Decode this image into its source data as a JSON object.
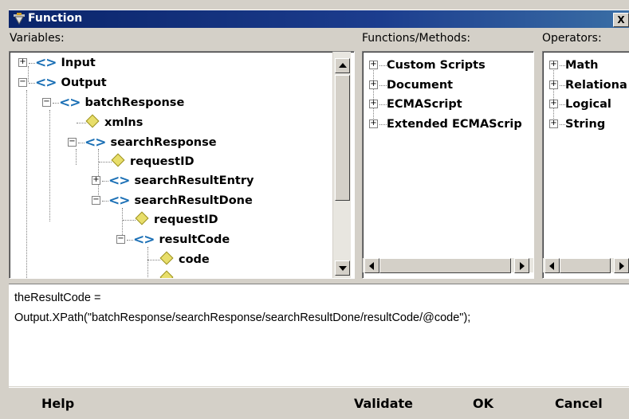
{
  "window": {
    "title": "Function",
    "close_label": "X"
  },
  "panels": {
    "variables": {
      "label": "Variables:",
      "items": [
        {
          "label": "Input",
          "type": "element",
          "expander": "+"
        },
        {
          "label": "Output",
          "type": "element",
          "expander": "−"
        },
        {
          "label": "batchResponse",
          "type": "element",
          "expander": "−"
        },
        {
          "label": "xmlns",
          "type": "attribute",
          "expander": ""
        },
        {
          "label": "searchResponse",
          "type": "element",
          "expander": "−"
        },
        {
          "label": "requestID",
          "type": "attribute",
          "expander": ""
        },
        {
          "label": "searchResultEntry",
          "type": "element",
          "expander": "+"
        },
        {
          "label": "searchResultDone",
          "type": "element",
          "expander": "−"
        },
        {
          "label": "requestID",
          "type": "attribute",
          "expander": ""
        },
        {
          "label": "resultCode",
          "type": "element",
          "expander": "−"
        },
        {
          "label": "code",
          "type": "attribute",
          "expander": ""
        }
      ]
    },
    "functions": {
      "label": "Functions/Methods:",
      "items": [
        {
          "label": "Custom Scripts",
          "expander": "+"
        },
        {
          "label": "Document",
          "expander": "+"
        },
        {
          "label": "ECMAScript",
          "expander": "+"
        },
        {
          "label": "Extended ECMAScrip",
          "expander": "+"
        }
      ]
    },
    "operators": {
      "label": "Operators:",
      "items": [
        {
          "label": "Math",
          "expander": "+"
        },
        {
          "label": "Relationa",
          "expander": "+"
        },
        {
          "label": "Logical",
          "expander": "+"
        },
        {
          "label": "String",
          "expander": "+"
        }
      ]
    }
  },
  "editor": {
    "line1": "theResultCode =",
    "line2": "Output.XPath(\"batchResponse/searchResponse/searchResultDone/resultCode/@code\");"
  },
  "footer": {
    "help": "Help",
    "validate": "Validate",
    "ok": "OK",
    "cancel": "Cancel"
  },
  "icons": {
    "element": "element-node-icon",
    "attribute": "attribute-node-icon",
    "window": "function-window-icon"
  },
  "colors": {
    "titlebar": "#0a246a",
    "element_icon": "#1a6fb5",
    "attribute_icon": "#e8de6a"
  }
}
